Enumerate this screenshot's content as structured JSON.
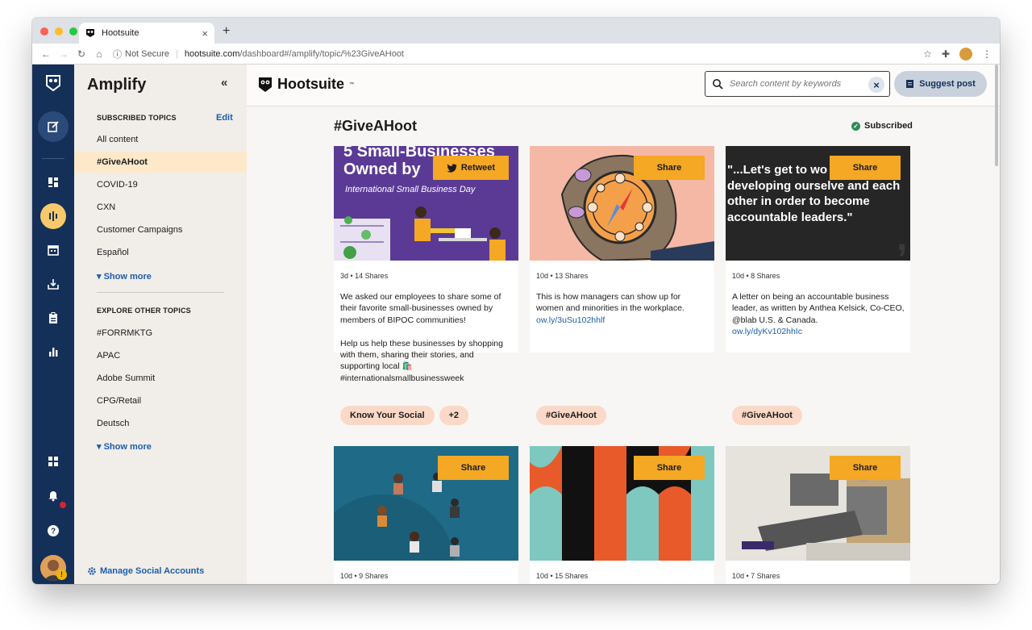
{
  "browser": {
    "tab_title": "Hootsuite",
    "new_tab": "+",
    "close": "×",
    "security_label": "Not Secure",
    "url_host": "hootsuite.com",
    "url_path": "/dashboard#/amplify/topic/%23GiveAHoot"
  },
  "sidebar": {
    "title": "Amplify",
    "collapse_label": "«",
    "subscribed_heading": "SUBSCRIBED TOPICS",
    "edit_label": "Edit",
    "subscribed_items": [
      {
        "label": "All content"
      },
      {
        "label": "#GiveAHoot"
      },
      {
        "label": "COVID-19"
      },
      {
        "label": "CXN"
      },
      {
        "label": "Customer Campaigns"
      },
      {
        "label": "Español"
      }
    ],
    "show_more_1": "Show more",
    "explore_heading": "EXPLORE OTHER TOPICS",
    "explore_items": [
      {
        "label": "#FORRMKTG"
      },
      {
        "label": "APAC"
      },
      {
        "label": "Adobe Summit"
      },
      {
        "label": "CPG/Retail"
      },
      {
        "label": "Deutsch"
      }
    ],
    "show_more_2": "Show more",
    "manage_label": "Manage Social Accounts"
  },
  "header": {
    "brand": "Hootsuite",
    "search_placeholder": "Search content by keywords",
    "suggest_label": "Suggest post"
  },
  "topic": {
    "title": "#GiveAHoot",
    "status": "Subscribed"
  },
  "cards": [
    {
      "image_headline": "5 Small-Businesses Owned by",
      "image_sub": "International Small Business Day",
      "button": "Retweet",
      "meta": "3d  •  14 Shares",
      "body": "We asked our employees to share some of their favorite small-businesses owned by members of BIPOC communities!\n\nHelp us help these businesses by shopping with them, sharing their stories, and supporting local 🛍️\n#internationalsmallbusinessweek",
      "link": "",
      "tags": [
        "Know Your Social",
        "+2"
      ]
    },
    {
      "button": "Share",
      "meta": "10d  •  13 Shares",
      "body": "This is how managers can show up for women and minorities in the workplace.",
      "link": "ow.ly/3uSu102hhlf",
      "tags": [
        "#GiveAHoot"
      ]
    },
    {
      "image_quote": "\"...Let's get to wo racism by developing ourselve and each other in order to become accountable leaders.\"",
      "button": "Share",
      "meta": "10d  •  8 Shares",
      "body": "A letter on being an accountable business leader, as written by Anthea Kelsick, Co-CEO, @blab U.S. & Canada.",
      "link": "ow.ly/dyKv102hhIc",
      "tags": [
        "#GiveAHoot"
      ]
    },
    {
      "button": "Share",
      "meta": "10d  •  9 Shares"
    },
    {
      "button": "Share",
      "meta": "10d  •  15 Shares"
    },
    {
      "button": "Share",
      "meta": "10d  •  7 Shares"
    }
  ],
  "colors": {
    "rail": "#143059",
    "accent": "#f4a823",
    "link": "#1c5ea8",
    "active_topic": "#fde9c9",
    "tag": "#fbd8c7"
  }
}
